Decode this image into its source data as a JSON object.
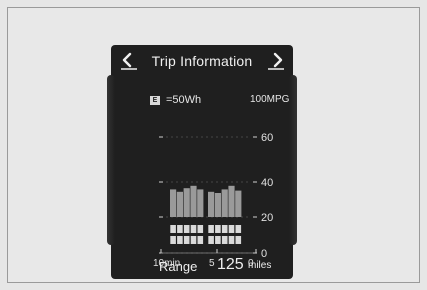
{
  "header": {
    "title": "Trip Information",
    "prev_icon": "chevron-left-icon",
    "next_icon": "chevron-right-icon"
  },
  "legend": {
    "badge": "E",
    "unit_text": "=50Wh",
    "mpg_label": "100MPG"
  },
  "chart_data": {
    "type": "bar",
    "x_tick_labels": [
      "10min",
      "5",
      "0"
    ],
    "y_tick_labels": [
      "60",
      "40",
      "20",
      "0"
    ],
    "ylim": [
      0,
      100
    ],
    "series": [
      {
        "values": [
          53,
          51,
          54,
          56,
          53,
          51,
          50,
          53,
          56,
          52
        ]
      }
    ],
    "regen_indicator_label": "E"
  },
  "footer": {
    "range_label": "Range",
    "range_value": "125",
    "range_unit": "miles"
  },
  "colors": {
    "screen_bg": "#1f1f1f",
    "bar_fill": "#9a9a9a",
    "regen_box": "#d8d8d8",
    "text": "#f0f0f0"
  }
}
